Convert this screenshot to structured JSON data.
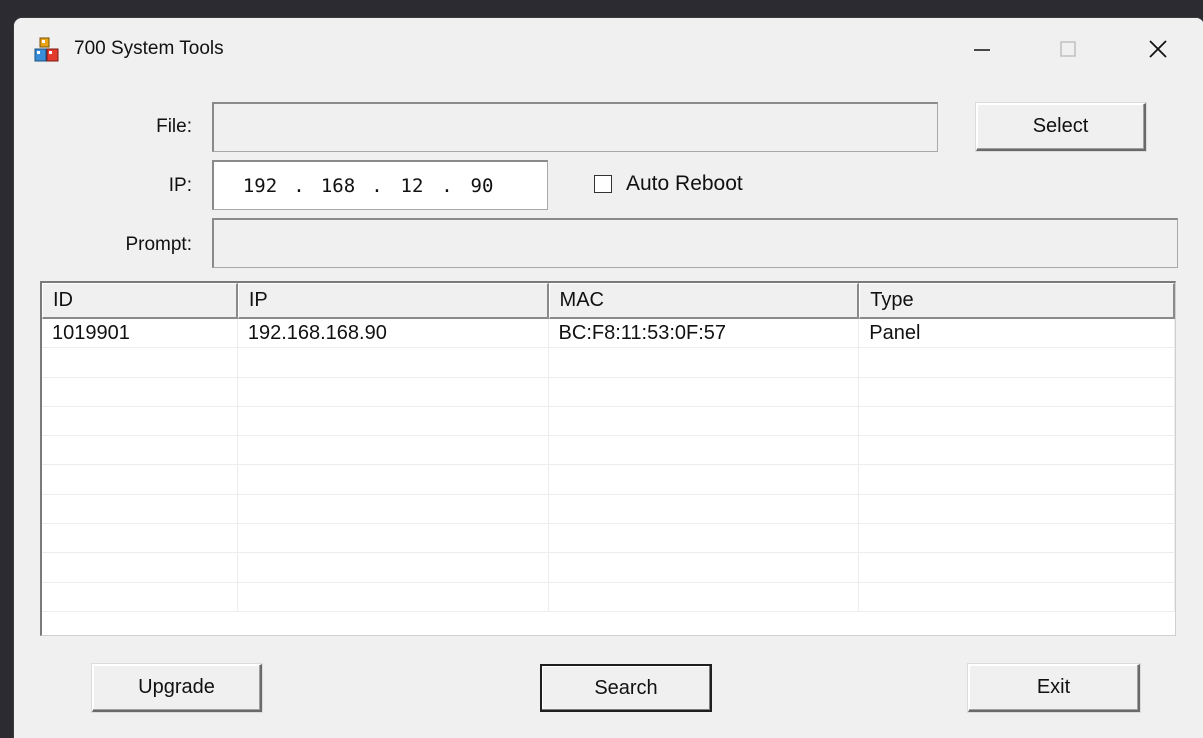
{
  "window": {
    "title": "700 System Tools"
  },
  "titlebar": {
    "minimize": "–",
    "maximize": "☐",
    "close": "✕"
  },
  "form": {
    "file_label": "File:",
    "file_value": "",
    "select_label": "Select",
    "ip_label": "IP:",
    "ip_octets": [
      "192",
      "168",
      "12",
      "90"
    ],
    "auto_reboot_label": "Auto Reboot",
    "auto_reboot_checked": false,
    "prompt_label": "Prompt:",
    "prompt_value": ""
  },
  "table": {
    "columns": [
      "ID",
      "IP",
      "MAC",
      "Type"
    ],
    "rows": [
      [
        "1019901",
        "192.168.168.90",
        "BC:F8:11:53:0F:57",
        "Panel"
      ],
      [
        "",
        "",
        "",
        ""
      ],
      [
        "",
        "",
        "",
        ""
      ],
      [
        "",
        "",
        "",
        ""
      ],
      [
        "",
        "",
        "",
        ""
      ],
      [
        "",
        "",
        "",
        ""
      ],
      [
        "",
        "",
        "",
        ""
      ],
      [
        "",
        "",
        "",
        ""
      ],
      [
        "",
        "",
        "",
        ""
      ],
      [
        "",
        "",
        "",
        ""
      ],
      [
        "",
        "",
        "",
        ""
      ]
    ]
  },
  "buttons": {
    "upgrade": "Upgrade",
    "search": "Search",
    "exit": "Exit"
  },
  "icons": {
    "app": "app-icon",
    "minimize": "minimize-icon",
    "maximize": "maximize-icon",
    "close": "close-icon"
  }
}
